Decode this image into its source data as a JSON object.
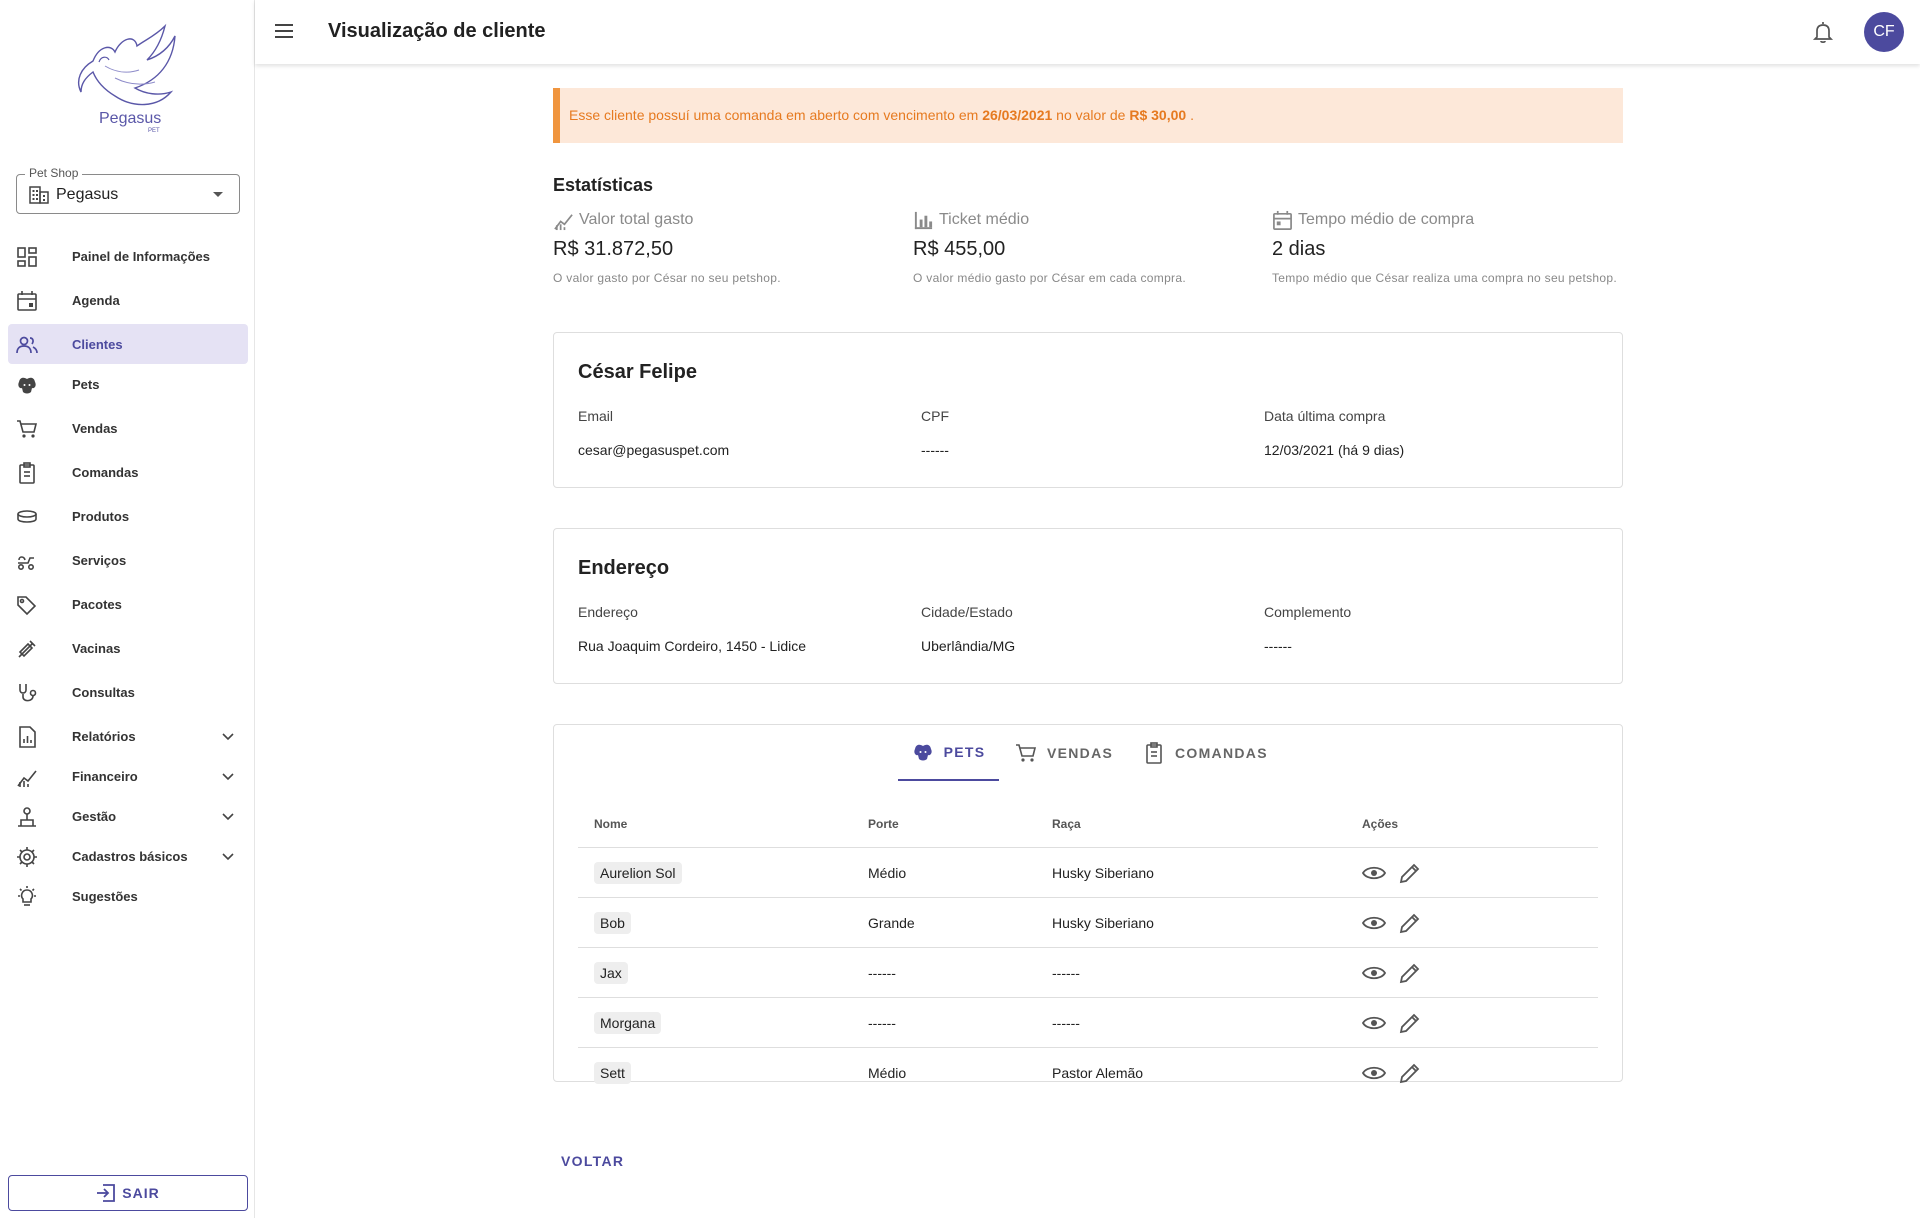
{
  "sidebar": {
    "brand_name": "Pegasus",
    "brand_sub": "PET",
    "shop_select": {
      "legend": "Pet Shop",
      "value": "Pegasus"
    },
    "items": [
      {
        "label": "Painel de Informações",
        "icon": "dashboard-icon"
      },
      {
        "label": "Agenda",
        "icon": "calendar-icon"
      },
      {
        "label": "Clientes",
        "icon": "people-icon",
        "active": true
      },
      {
        "label": "Pets",
        "icon": "pet-icon"
      },
      {
        "label": "Vendas",
        "icon": "cart-icon"
      },
      {
        "label": "Comandas",
        "icon": "clipboard-icon"
      },
      {
        "label": "Produtos",
        "icon": "bowl-icon"
      },
      {
        "label": "Serviços",
        "icon": "grooming-icon"
      },
      {
        "label": "Pacotes",
        "icon": "tags-icon"
      },
      {
        "label": "Vacinas",
        "icon": "syringe-icon"
      },
      {
        "label": "Consultas",
        "icon": "stethoscope-icon"
      },
      {
        "label": "Relatórios",
        "icon": "report-icon",
        "expandable": true
      },
      {
        "label": "Financeiro",
        "icon": "finance-icon",
        "expandable": true
      },
      {
        "label": "Gestão",
        "icon": "management-icon",
        "expandable": true
      },
      {
        "label": "Cadastros básicos",
        "icon": "gear-icon",
        "expandable": true
      },
      {
        "label": "Sugestões",
        "icon": "lightbulb-icon"
      }
    ],
    "logout_label": "SAIR"
  },
  "header": {
    "title": "Visualização de cliente",
    "avatar_initials": "CF"
  },
  "alert": {
    "text_before": "Esse cliente possuí uma comanda em aberto com vencimento em",
    "due_date": "26/03/2021",
    "text_middle": "no valor de",
    "amount": "R$ 30,00",
    "text_end": "."
  },
  "stats": {
    "title": "Estatísticas",
    "items": [
      {
        "label": "Valor total gasto",
        "value": "R$ 31.872,50",
        "description": "O valor gasto por César no seu petshop.",
        "icon": "trend-icon"
      },
      {
        "label": "Ticket médio",
        "value": "R$ 455,00",
        "description": "O valor médio gasto por César em cada compra.",
        "icon": "bar-chart-icon"
      },
      {
        "label": "Tempo médio de compra",
        "value": "2 dias",
        "description": "Tempo médio que César realiza uma compra no seu petshop.",
        "icon": "calendar-icon"
      }
    ]
  },
  "client": {
    "name": "César Felipe",
    "email_label": "Email",
    "email": "cesar@pegasuspet.com",
    "cpf_label": "CPF",
    "cpf": "------",
    "last_purchase_label": "Data última compra",
    "last_purchase": "12/03/2021 (há 9 dias)"
  },
  "address": {
    "title": "Endereço",
    "street_label": "Endereço",
    "street": "Rua Joaquim Cordeiro, 1450 - Lidice",
    "city_label": "Cidade/Estado",
    "city": "Uberlândia/MG",
    "complement_label": "Complemento",
    "complement": "------"
  },
  "tabs": [
    {
      "label": "PETS",
      "icon": "pet-icon",
      "active": true
    },
    {
      "label": "VENDAS",
      "icon": "cart-icon"
    },
    {
      "label": "COMANDAS",
      "icon": "clipboard-icon"
    }
  ],
  "pets_table": {
    "columns": [
      "Nome",
      "Porte",
      "Raça",
      "Ações"
    ],
    "rows": [
      {
        "nome": "Aurelion Sol",
        "porte": "Médio",
        "raca": "Husky Siberiano"
      },
      {
        "nome": "Bob",
        "porte": "Grande",
        "raca": "Husky Siberiano"
      },
      {
        "nome": "Jax",
        "porte": "------",
        "raca": "------"
      },
      {
        "nome": "Morgana",
        "porte": "------",
        "raca": "------"
      },
      {
        "nome": "Sett",
        "porte": "Médio",
        "raca": "Pastor Alemão"
      }
    ]
  },
  "back_label": "VOLTAR",
  "colors": {
    "accent": "#4c4a9e",
    "alert_bg": "#fde8d9",
    "alert_text": "#e67a20"
  }
}
